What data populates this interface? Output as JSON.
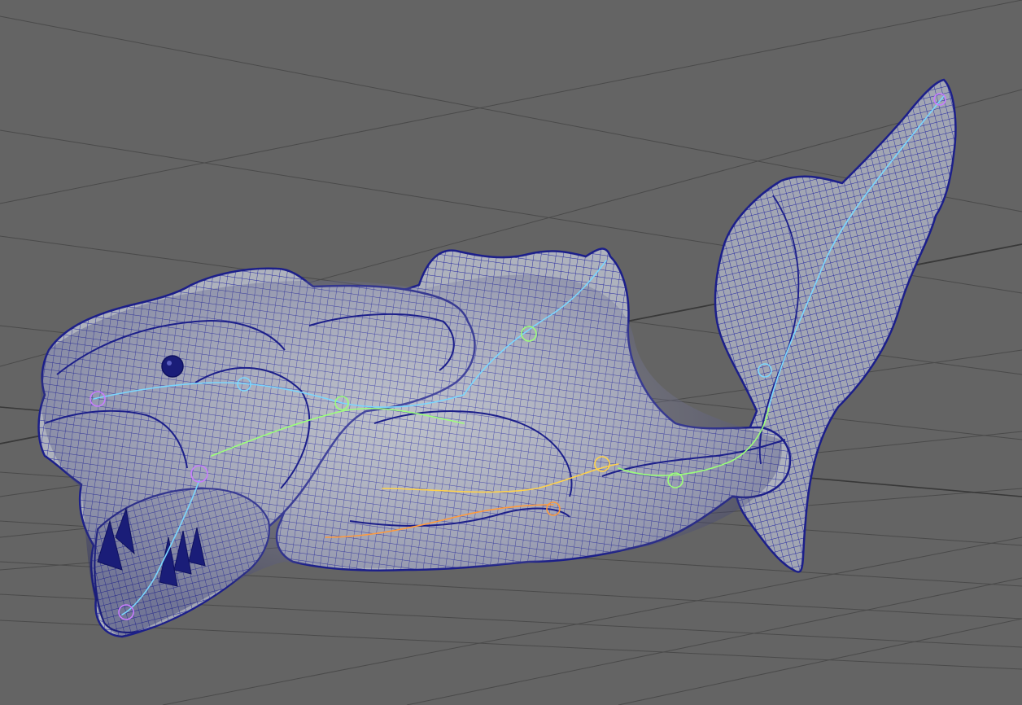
{
  "viewport": {
    "background_color": "#646464",
    "grid_color": "#4a4a4a",
    "axis_color": "#383838",
    "mesh_fill_color": "#a9adb8",
    "wireframe_color": "#1c1f8a",
    "skeleton_colors": [
      "#7ad6ff",
      "#9cff7a",
      "#ffd24a",
      "#ff9a3c",
      "#c77dff"
    ]
  },
  "model": {
    "shading": "wireframe-on-shaded",
    "icon": "creature-mesh-icon"
  }
}
